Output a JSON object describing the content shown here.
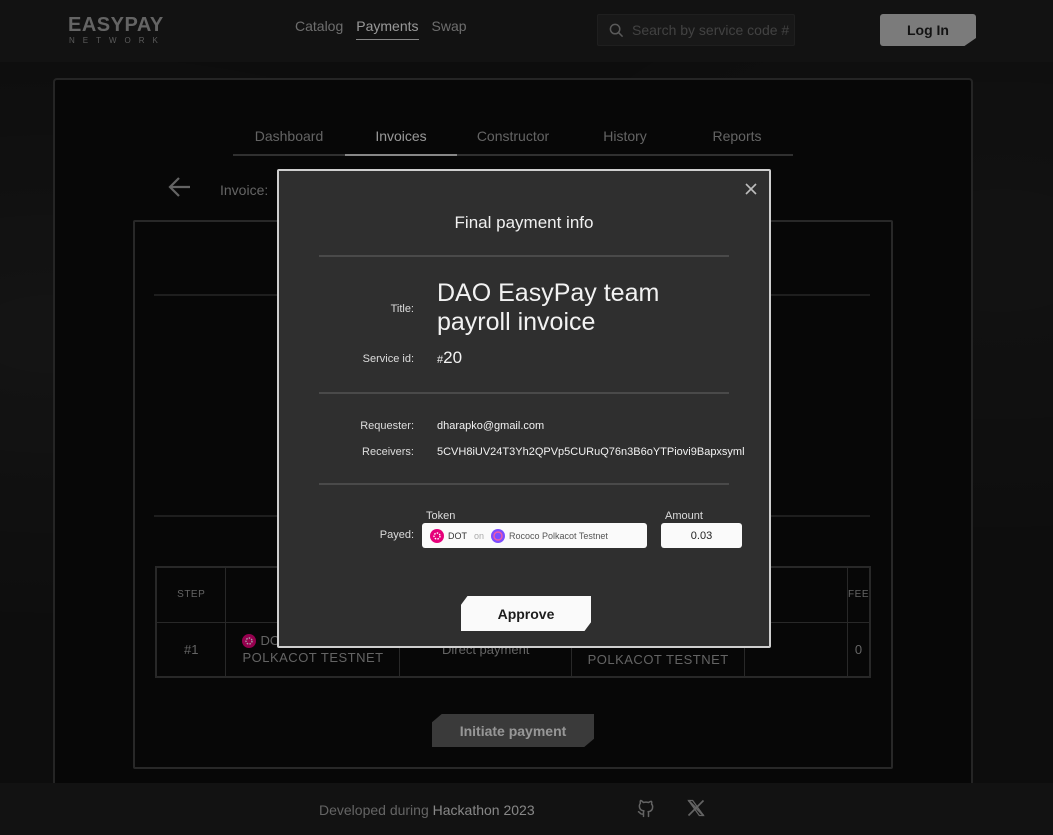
{
  "brand": {
    "name": "EASYPAY",
    "subtitle": "NETWORK"
  },
  "nav": [
    {
      "label": "Catalog"
    },
    {
      "label": "Payments",
      "active": true
    },
    {
      "label": "Swap"
    }
  ],
  "search": {
    "placeholder": "Search by service code #",
    "icon": "search-icon"
  },
  "header": {
    "login_label": "Log In"
  },
  "tabs": [
    {
      "label": "Dashboard"
    },
    {
      "label": "Invoices",
      "active": true
    },
    {
      "label": "Constructor"
    },
    {
      "label": "History"
    },
    {
      "label": "Reports"
    }
  ],
  "invoice": {
    "label": "Invoice:"
  },
  "steps_table": {
    "headers": [
      "STEP",
      "",
      "",
      "",
      "",
      "FEE"
    ],
    "rows": [
      {
        "step": "#1",
        "from_token_partial": "DO",
        "from_network": "Polkacot Testnet",
        "method": "Direct payment",
        "to_network": "Polkacot Testnet",
        "fee": "0"
      }
    ]
  },
  "initiate_label": "Initiate payment",
  "footer": {
    "text_prefix": "Developed during",
    "text_event": "Hackathon 2023",
    "icons": [
      "github-icon",
      "x-icon"
    ]
  },
  "modal": {
    "title": "Final payment info",
    "title_label": "Title:",
    "title_value": "DAO EasyPay team payroll invoice",
    "service_label": "Service id:",
    "service_hash": "#",
    "service_value": "20",
    "requester_label": "Requester:",
    "requester_value": "dharapko@gmail.com",
    "receivers_label": "Receivers:",
    "receivers_value": "5CVH8iUV24T3Yh2QPVp5CURuQ76n3B6oYTPiovi9Bapxsyml",
    "payed_label": "Payed:",
    "token_caption": "Token",
    "amount_caption": "Amount",
    "token_symbol": "DOT",
    "token_on": "on",
    "token_network": "Rococo Polkacot Testnet",
    "amount_value": "0.03",
    "approve_label": "Approve"
  },
  "colors": {
    "background": "#141414",
    "modal": "#2f2f2f",
    "accent_dot": "#e6007a",
    "accent_network": "#7b4dff"
  }
}
